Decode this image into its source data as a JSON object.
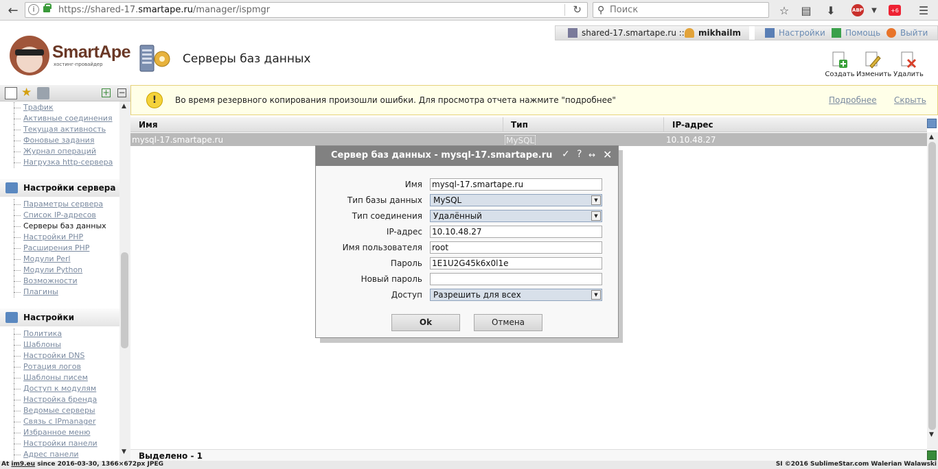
{
  "browser": {
    "url_prefix": "https://shared-17.",
    "url_domain": "smartape.ru",
    "url_path": "/manager/ispmgr",
    "search_placeholder": "Поиск"
  },
  "userbar": {
    "host": "shared-17.smartape.ru ::",
    "user": "mikhailm",
    "settings": "Настройки",
    "help": "Помощь",
    "logout": "Выйти"
  },
  "logo": {
    "brand": "SmartApe",
    "tagline": "хостинг-провайдер"
  },
  "page": {
    "title": "Серверы баз данных"
  },
  "actions": {
    "create": "Создать",
    "edit": "Изменить",
    "delete": "Удалить"
  },
  "sidebar": {
    "group1": [
      "Трафик",
      "Активные соединения",
      "Текущая активность",
      "Фоновые задания",
      "Журнал операций",
      "Нагрузка http-сервера"
    ],
    "section2": "Настройки сервера",
    "group2": [
      "Параметры сервера",
      "Список IP-адресов",
      "Серверы баз данных",
      "Настройки PHP",
      "Расширения PHP",
      "Модули Perl",
      "Модули Python",
      "Возможности",
      "Плагины"
    ],
    "section3": "Настройки",
    "group3": [
      "Политика",
      "Шаблоны",
      "Настройки DNS",
      "Ротация логов",
      "Шаблоны писем",
      "Доступ к модулям",
      "Настройка бренда",
      "Ведомые серверы",
      "Связь с IPmanager",
      "Избранное меню",
      "Настройки панели",
      "Адрес панели"
    ]
  },
  "notice": {
    "message": "Во время резервного копирования произошли ошибки. Для просмотра отчета нажмите \"подробнее\"",
    "details": "Подробнее",
    "hide": "Скрыть"
  },
  "table": {
    "headers": {
      "name": "Имя",
      "type": "Тип",
      "ip": "IP-адрес"
    },
    "row": {
      "name": "mysql-17.smartape.ru",
      "type": "MySQL",
      "ip": "10.10.48.27"
    },
    "footer": "Выделено - 1"
  },
  "dialog": {
    "title": "Сервер баз данных - mysql-17.smartape.ru",
    "labels": {
      "name": "Имя",
      "db_type": "Тип базы данных",
      "conn_type": "Тип соединения",
      "ip": "IP-адрес",
      "user": "Имя пользователя",
      "password": "Пароль",
      "new_password": "Новый пароль",
      "access": "Доступ"
    },
    "values": {
      "name": "mysql-17.smartape.ru",
      "db_type": "MySQL",
      "conn_type": "Удалённый",
      "ip": "10.10.48.27",
      "user": "root",
      "password": "1E1U2G45k6x0l1e",
      "new_password": "",
      "access": "Разрешить для всех"
    },
    "ok": "Ok",
    "cancel": "Отмена"
  },
  "watermark": {
    "left_prefix": "At ",
    "left_link": "im9.eu",
    "left_suffix": " since 2016-03-30, 1366×672px JPEG",
    "right": "SI ©2016 SublimeStar.com Walerian Walawski"
  }
}
